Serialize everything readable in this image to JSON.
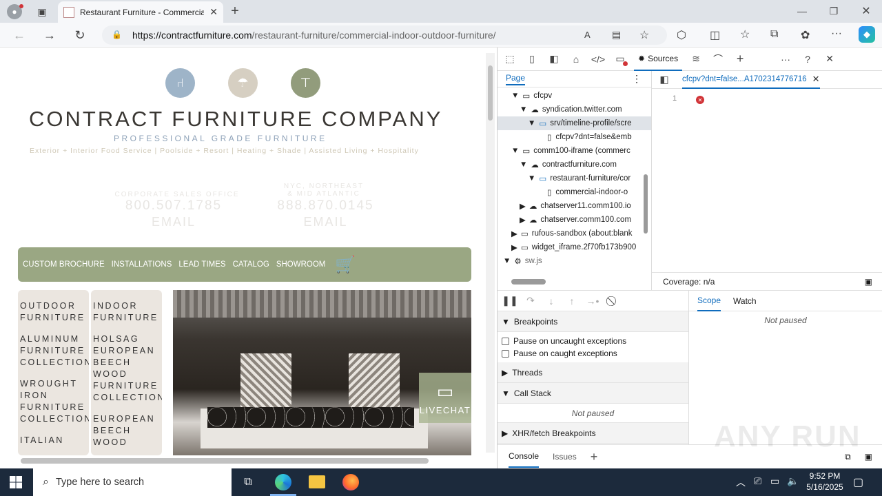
{
  "browser": {
    "tab_title": "Restaurant Furniture - Commercial",
    "url_domain": "https://contractfurniture.com",
    "url_path": "/restaurant-furniture/commercial-indoor-outdoor-furniture/"
  },
  "site": {
    "brand_name": "CONTRACT FURNITURE COMPANY",
    "tagline": "PROFESSIONAL GRADE FURNITURE",
    "subtag": "Exterior + Interior Food Service | Poolside + Resort | Heating + Shade | Assisted Living + Hospitality",
    "office1_label": "CORPORATE SALES OFFICE",
    "office1_phone": "800.507.1785",
    "office1_email": "EMAIL",
    "office2_label1": "NYC, NORTHEAST",
    "office2_label2": "& MID ATLANTIC",
    "office2_phone": "888.870.0145",
    "office2_email": "EMAIL",
    "nav": [
      "CUSTOM BROCHURE",
      "INSTALLATIONS",
      "LEAD TIMES",
      "CATALOG",
      "SHOWROOM"
    ],
    "col1": [
      "OUTDOOR FURNITURE",
      "ALUMINUM FURNITURE COLLECTIONS",
      "WROUGHT IRON FURNITURE COLLECTIONS",
      "ITALIAN"
    ],
    "col2": [
      "INDOOR FURNITURE",
      "HOLSAG EUROPEAN BEECH WOOD FURNITURE COLLECTION",
      "EUROPEAN BEECH WOOD"
    ],
    "livechat": "LIVECHAT"
  },
  "devtools": {
    "sources_tab": "Sources",
    "page_tab": "Page",
    "tree": [
      "cfcpv",
      "syndication.twitter.com",
      "srv/timeline-profile/scre",
      "cfcpv?dnt=false&emb",
      "comm100-iframe (commerc",
      "contractfurniture.com",
      "restaurant-furniture/cor",
      "commercial-indoor-o",
      "chatserver11.comm100.io",
      "chatserver.comm100.com",
      "rufous-sandbox (about:blank",
      "widget_iframe.2f70fb173b900",
      "sw.js"
    ],
    "editor_tab": "cfcpv?dnt=false...A1702314776716",
    "line_number": "1",
    "coverage": "Coverage: n/a",
    "breakpoints": "Breakpoints",
    "pause_uncaught": "Pause on uncaught exceptions",
    "pause_caught": "Pause on caught exceptions",
    "threads": "Threads",
    "call_stack": "Call Stack",
    "not_paused": "Not paused",
    "xhr": "XHR/fetch Breakpoints",
    "scope": "Scope",
    "watch": "Watch",
    "scope_not_paused": "Not paused",
    "console": "Console",
    "issues": "Issues"
  },
  "taskbar": {
    "search_placeholder": "Type here to search",
    "time": "9:52 PM",
    "date": "5/16/2025"
  },
  "watermark": "ANY RUN"
}
